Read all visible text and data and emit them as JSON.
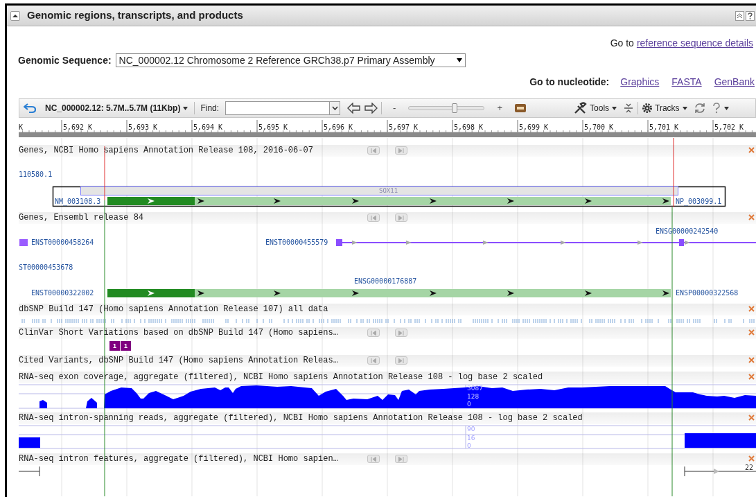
{
  "panel": {
    "title": "Genomic regions, transcripts, and products",
    "expanded": true
  },
  "reference_link": {
    "prefix": "Go to",
    "link": "reference sequence details"
  },
  "genomic_sequence": {
    "label": "Genomic Sequence:",
    "value": "NC_000002.12 Chromosome 2 Reference GRCh38.p7 Primary Assembly"
  },
  "nucleotide_links": {
    "label": "Go to nucleotide:",
    "links": [
      "Graphics",
      "FASTA",
      "GenBank"
    ]
  },
  "toolbar": {
    "region": "NC_000002.12: 5.7M..5.7M (11Kbp)",
    "find_label": "Find:",
    "zoom_out": "-",
    "zoom_in": "+",
    "zoom": {
      "level": 0.62
    },
    "tools": "Tools",
    "tracks": "Tracks"
  },
  "ruler": [
    "K",
    "5,692 K",
    "5,693 K",
    "5,694 K",
    "5,695 K",
    "5,696 K",
    "5,697 K",
    "5,698 K",
    "5,699 K",
    "5,700 K",
    "5,701 K",
    "5,702 K"
  ],
  "tracks": [
    {
      "kind": "genes_ncbi",
      "title": "Genes, NCBI Homo sapiens Annotation Release 108, 2016-06-07",
      "nav": true,
      "features": [
        "110580.1",
        "SOX11",
        "NM_003108.3",
        "NP_003099.1"
      ]
    },
    {
      "kind": "genes_ensembl",
      "title": "Genes, Ensembl release 84",
      "nav": true,
      "features": [
        "ENST00000458264",
        "ENST00000455579",
        "ENSG00000242540",
        "ST00000453678",
        "ENSG00000176887",
        "ENST00000322002",
        "ENSP00000322568"
      ]
    },
    {
      "kind": "snp",
      "title": "dbSNP Build 147 (Homo sapiens Annotation Release 107) all data",
      "nav": false
    },
    {
      "kind": "clinvar",
      "title": "ClinVar Short Variations based on dbSNP Build 147 (Homo sapiens…",
      "nav": true,
      "badges": [
        "1",
        "1"
      ]
    },
    {
      "kind": "empty",
      "title": "Cited Variants, dbSNP Build 147 (Homo sapiens Annotation Releas…",
      "nav": true
    },
    {
      "kind": "coverage",
      "title": "RNA-seq exon coverage, aggregate (filtered), NCBI Homo sapiens Annotation Release 108 - log base 2 scaled",
      "nav": false,
      "axis": [
        "3087",
        "128",
        "0"
      ]
    },
    {
      "kind": "intron_reads",
      "title": "RNA-seq intron-spanning reads, aggregate (filtered), NCBI Homo sapiens Annotation Release 108 - log base 2 scaled",
      "nav": false,
      "axis": [
        "90",
        "16",
        "0"
      ]
    },
    {
      "kind": "intron_features",
      "title": "RNA-seq intron features, aggregate (filtered), NCBI Homo sapien…",
      "nav": true,
      "features": [
        "22"
      ]
    }
  ]
}
